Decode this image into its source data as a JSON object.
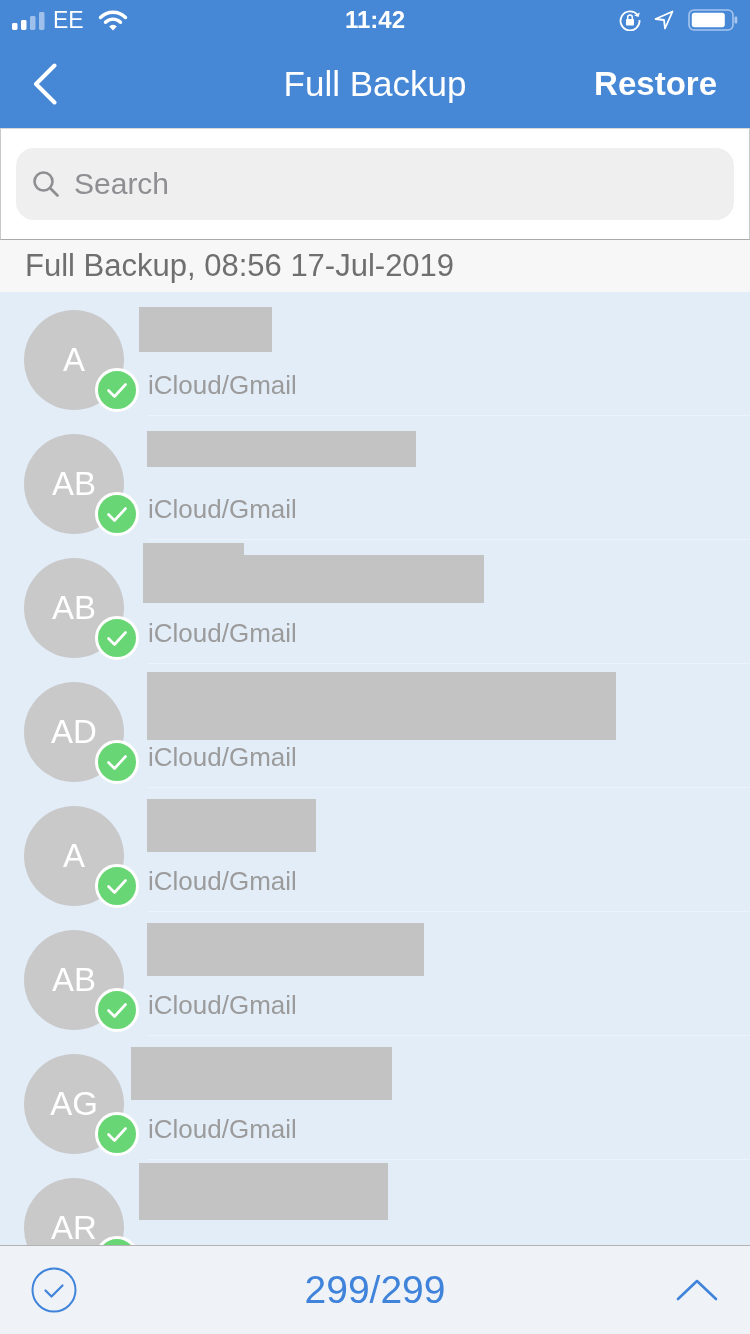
{
  "status_bar": {
    "carrier": "EE",
    "time": "11:42"
  },
  "nav_bar": {
    "title": "Full Backup",
    "action": "Restore"
  },
  "search": {
    "placeholder": "Search"
  },
  "section_header": "Full Backup, 08:56 17-Jul-2019",
  "contacts": [
    {
      "initials": "A",
      "source": "iCloud/Gmail",
      "checked": true
    },
    {
      "initials": "AB",
      "source": "iCloud/Gmail",
      "checked": true
    },
    {
      "initials": "AB",
      "source": "iCloud/Gmail",
      "checked": true
    },
    {
      "initials": "AD",
      "source": "iCloud/Gmail",
      "checked": true
    },
    {
      "initials": "A",
      "source": "iCloud/Gmail",
      "checked": true
    },
    {
      "initials": "AB",
      "source": "iCloud/Gmail",
      "checked": true
    },
    {
      "initials": "AG",
      "source": "iCloud/Gmail",
      "checked": true
    },
    {
      "initials": "AR",
      "checked": true
    }
  ],
  "bottom_bar": {
    "counter": "299/299"
  }
}
